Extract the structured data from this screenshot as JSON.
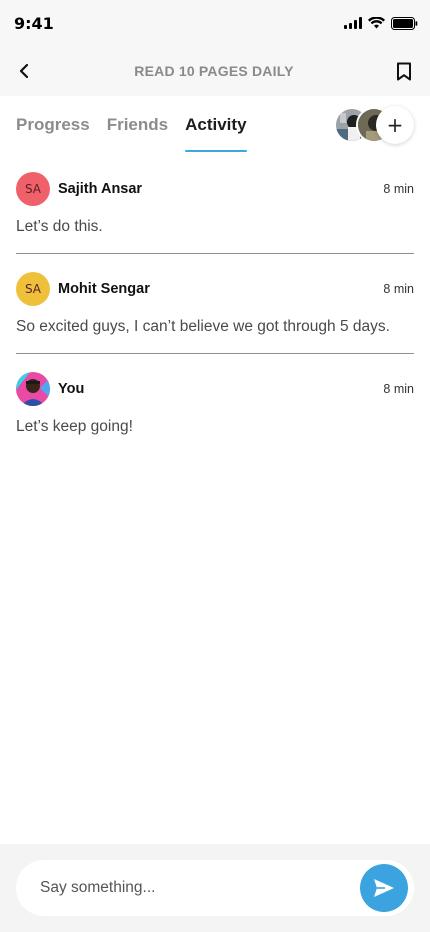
{
  "status": {
    "time": "9:41"
  },
  "nav": {
    "title": "READ 10 PAGES DAILY"
  },
  "tabs": [
    {
      "label": "Progress",
      "active": false
    },
    {
      "label": "Friends",
      "active": false
    },
    {
      "label": "Activity",
      "active": true
    }
  ],
  "colors": {
    "accent": "#3aa3e0",
    "avatar_red": "#f0606a",
    "avatar_yellow": "#efc13b"
  },
  "posts": [
    {
      "initials": "SA",
      "author": "Sajith Ansar",
      "time": "8 min",
      "message": "Let’s do this."
    },
    {
      "initials": "SA",
      "author": "Mohit Sengar",
      "time": "8 min",
      "message": "So excited guys, I can’t believe we got through 5 days."
    },
    {
      "initials": "",
      "author": "You",
      "time": "8 min",
      "message": "Let’s keep going!"
    }
  ],
  "composer": {
    "placeholder": "Say something..."
  }
}
